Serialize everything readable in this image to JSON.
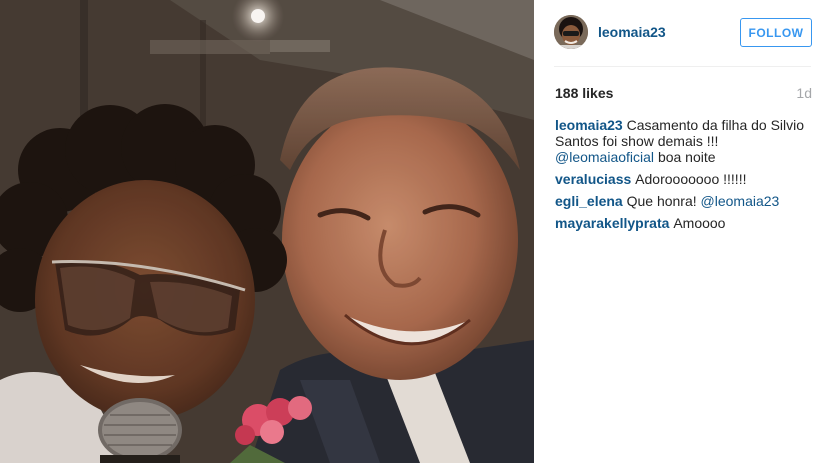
{
  "photo": {
    "alt": ""
  },
  "author": {
    "username": "leomaia23",
    "avatar_icon": "profile-avatar"
  },
  "follow_button": {
    "label": "FOLLOW"
  },
  "stats": {
    "likes": "188 likes",
    "age": "1d"
  },
  "caption": {
    "username": "leomaia23",
    "text_1": "Casamento da filha do Silvio Santos foi show demais !!! ",
    "mention": "@leomaiaoficial",
    "text_2": " boa noite"
  },
  "comments": [
    {
      "username": "veraluciass",
      "text": "Adorooooooo !!!!!!",
      "mention": ""
    },
    {
      "username": "egli_elena",
      "text": "Que honra! ",
      "mention": "@leomaia23"
    },
    {
      "username": "mayarakellyprata",
      "text": "Amoooo",
      "mention": ""
    }
  ],
  "colors": {
    "username_link": "#125688",
    "follow_blue": "#3897f0",
    "muted": "#a5a7aa",
    "divider": "#efefef"
  }
}
